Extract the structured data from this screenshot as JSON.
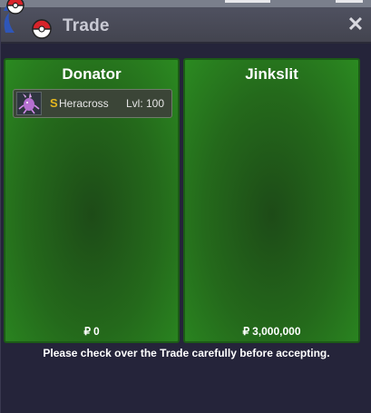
{
  "window": {
    "title": "Trade",
    "close_symbol": "✕",
    "logo_icon": "pokeball-logo-icon"
  },
  "trade": {
    "left": {
      "name": "Donator",
      "currency_symbol": "₽",
      "money": "0",
      "items": [
        {
          "icon": "heracross-sprite-icon",
          "shiny_mark": "S",
          "name": "Heracross",
          "level": "Lvl: 100"
        }
      ]
    },
    "right": {
      "name": "Jinkslit",
      "currency_symbol": "₽",
      "money": "3,000,000",
      "items": []
    }
  },
  "notice": "Please check over the Trade carefully before accepting.",
  "colors": {
    "panel_green": "#2b8a21",
    "panel_border": "#1c5a17",
    "shiny_gold": "#e5b81f",
    "window_bg": "#25243a",
    "titlebar": "#4f5160"
  }
}
